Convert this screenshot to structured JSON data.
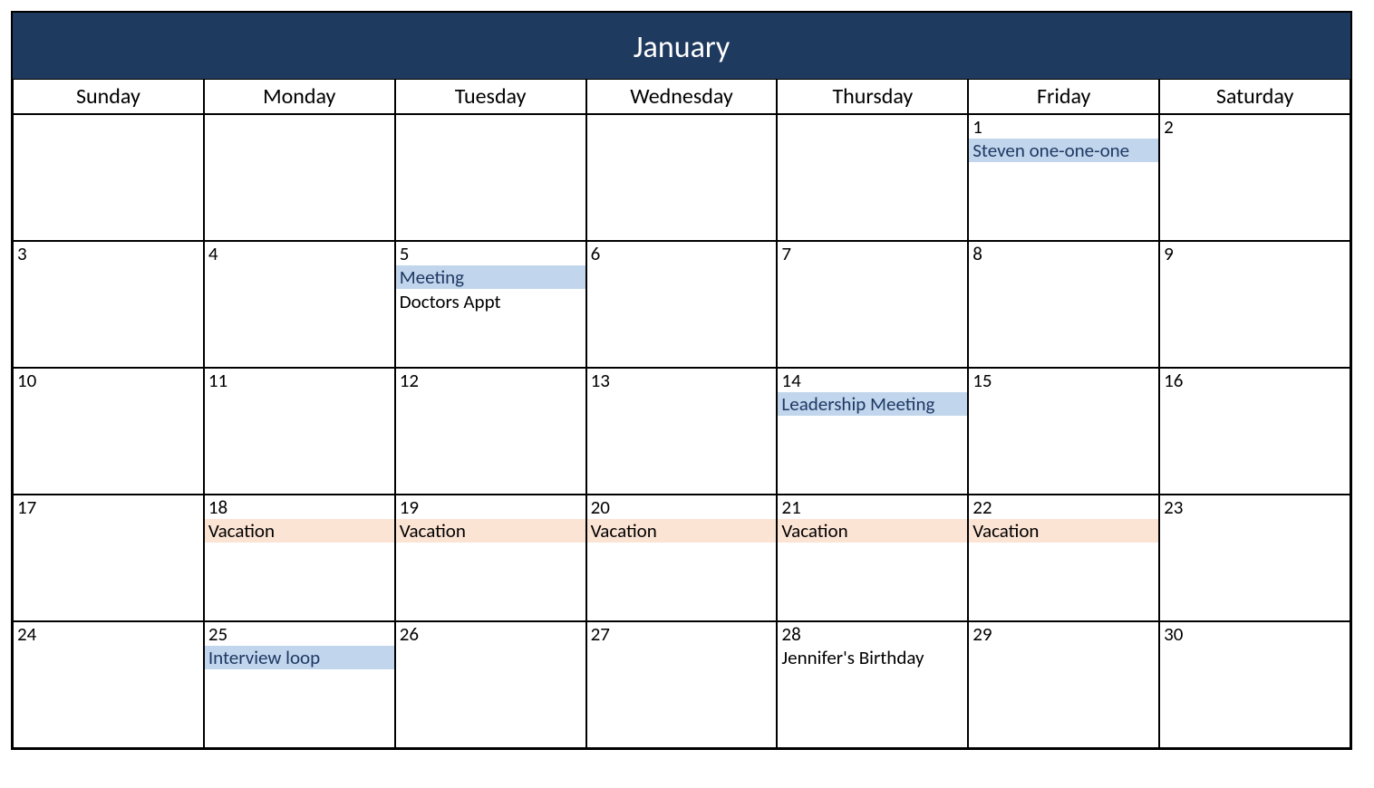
{
  "month_title": "January",
  "day_names": [
    "Sunday",
    "Monday",
    "Tuesday",
    "Wednesday",
    "Thursday",
    "Friday",
    "Saturday"
  ],
  "colors": {
    "header_bg": "#1f3a5f",
    "event_blue": "#c1d6ec",
    "event_peach": "#fce4d4"
  },
  "weeks": [
    [
      {
        "num": "",
        "events": []
      },
      {
        "num": "",
        "events": []
      },
      {
        "num": "",
        "events": []
      },
      {
        "num": "",
        "events": []
      },
      {
        "num": "",
        "events": []
      },
      {
        "num": "1",
        "events": [
          {
            "text": "Steven one-one-one",
            "style": "blue"
          }
        ]
      },
      {
        "num": "2",
        "events": []
      }
    ],
    [
      {
        "num": "3",
        "events": []
      },
      {
        "num": "4",
        "events": []
      },
      {
        "num": "5",
        "events": [
          {
            "text": "Meeting",
            "style": "blue"
          },
          {
            "text": "Doctors Appt",
            "style": "plain"
          }
        ]
      },
      {
        "num": "6",
        "events": []
      },
      {
        "num": "7",
        "events": []
      },
      {
        "num": "8",
        "events": []
      },
      {
        "num": "9",
        "events": []
      }
    ],
    [
      {
        "num": "10",
        "events": []
      },
      {
        "num": "11",
        "events": []
      },
      {
        "num": "12",
        "events": []
      },
      {
        "num": "13",
        "events": []
      },
      {
        "num": "14",
        "events": [
          {
            "text": "Leadership Meeting",
            "style": "blue"
          }
        ]
      },
      {
        "num": "15",
        "events": []
      },
      {
        "num": "16",
        "events": []
      }
    ],
    [
      {
        "num": "17",
        "events": []
      },
      {
        "num": "18",
        "events": [
          {
            "text": "Vacation",
            "style": "peach"
          }
        ]
      },
      {
        "num": "19",
        "events": [
          {
            "text": "Vacation",
            "style": "peach"
          }
        ]
      },
      {
        "num": "20",
        "events": [
          {
            "text": "Vacation",
            "style": "peach"
          }
        ]
      },
      {
        "num": "21",
        "events": [
          {
            "text": "Vacation",
            "style": "peach"
          }
        ]
      },
      {
        "num": "22",
        "events": [
          {
            "text": "Vacation",
            "style": "peach"
          }
        ]
      },
      {
        "num": "23",
        "events": []
      }
    ],
    [
      {
        "num": "24",
        "events": []
      },
      {
        "num": "25",
        "events": [
          {
            "text": "Interview loop",
            "style": "blue"
          }
        ]
      },
      {
        "num": "26",
        "events": []
      },
      {
        "num": "27",
        "events": []
      },
      {
        "num": "28",
        "events": [
          {
            "text": "Jennifer's Birthday",
            "style": "plain"
          }
        ]
      },
      {
        "num": "29",
        "events": []
      },
      {
        "num": "30",
        "events": []
      }
    ]
  ]
}
